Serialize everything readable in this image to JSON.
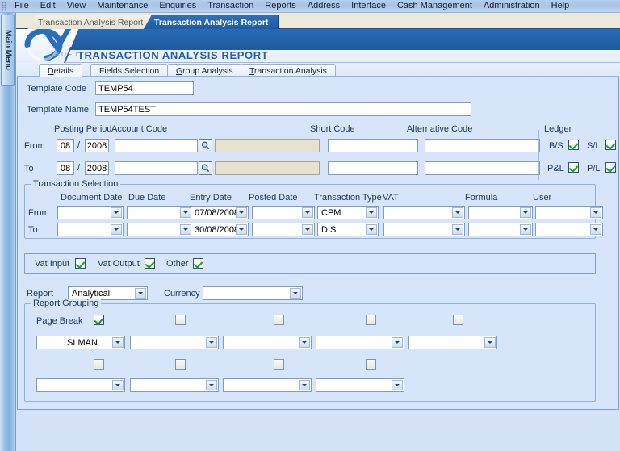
{
  "menubar": {
    "items": [
      "File",
      "Edit",
      "View",
      "Maintenance",
      "Enquiries",
      "Transaction",
      "Reports",
      "Address",
      "Interface",
      "Cash Management",
      "Administration",
      "Help"
    ]
  },
  "sidebar": {
    "label": "Main Menu"
  },
  "window_tabs": [
    {
      "label": "Transaction Analysis Report",
      "active": false
    },
    {
      "label": "Transaction Analysis Report",
      "active": true
    }
  ],
  "banner": {
    "title": "TRANSACTION ANALYSIS REPORT",
    "logo_text": "SOFT"
  },
  "inner_tabs": [
    {
      "label": "Details",
      "accel": "D",
      "selected": true
    },
    {
      "label": "Fields Selection",
      "accel": "",
      "selected": false
    },
    {
      "label": "Group Analysis",
      "accel": "G",
      "selected": false
    },
    {
      "label": "Transaction Analysis",
      "accel": "T",
      "selected": false
    }
  ],
  "form": {
    "template_code_label": "Template Code",
    "template_code_value": "TEMP54",
    "template_name_label": "Template Name",
    "template_name_value": "TEMP54TEST",
    "col_headers": {
      "posting_period": "Posting Period",
      "account_code": "Account Code",
      "short_code": "Short Code",
      "alternative_code": "Alternative Code",
      "ledger": "Ledger"
    },
    "row_from_label": "From",
    "row_to_label": "To",
    "from": {
      "period_month": "08",
      "period_sep": "/",
      "period_year": "2008",
      "account_code": "",
      "account_desc": "",
      "short_code": "",
      "alternative_code": ""
    },
    "to": {
      "period_month": "08",
      "period_sep": "/",
      "period_year": "2008",
      "account_code": "",
      "account_desc": "",
      "short_code": "",
      "alternative_code": ""
    },
    "ledger": {
      "bs_label": "B/S",
      "bs_checked": true,
      "sl_label": "S/L",
      "sl_checked": true,
      "pl_label": "P&L",
      "pl_checked": true,
      "pl2_label": "P/L",
      "pl2_checked": true
    }
  },
  "transaction_selection": {
    "title": "Transaction Selection",
    "row_from_label": "From",
    "row_to_label": "To",
    "headers": {
      "document_date": "Document Date",
      "due_date": "Due Date",
      "entry_date": "Entry Date",
      "posted_date": "Posted Date",
      "transaction_type": "Transaction Type",
      "vat": "VAT",
      "formula": "Formula",
      "user": "User"
    },
    "from": {
      "document_date": "",
      "due_date": "",
      "entry_date": "07/08/2008",
      "posted_date": "",
      "transaction_type": "CPM",
      "vat": "",
      "formula": "",
      "user": ""
    },
    "to": {
      "document_date": "",
      "due_date": "",
      "entry_date": "30/08/2008",
      "posted_date": "",
      "transaction_type": "DIS",
      "vat": "",
      "formula": "",
      "user": ""
    }
  },
  "vat_bar": {
    "vat_input_label": "Vat Input",
    "vat_input_checked": true,
    "vat_output_label": "Vat Output",
    "vat_output_checked": true,
    "other_label": "Other",
    "other_checked": true
  },
  "report_row": {
    "report_label": "Report",
    "report_value": "Analytical",
    "currency_label": "Currency",
    "currency_value": ""
  },
  "report_grouping": {
    "title": "Report Grouping",
    "page_break_label": "Page Break",
    "row1": {
      "checks": [
        true,
        false,
        false,
        false,
        false
      ],
      "values": [
        "SLMAN",
        "",
        "",
        "",
        ""
      ]
    },
    "row2": {
      "checks": [
        false,
        false,
        false,
        false
      ],
      "values": [
        "",
        "",
        "",
        ""
      ]
    }
  },
  "colors": {
    "panel_bg": "#d6e5f9",
    "accent_blue": "#1d5aa4",
    "title_blue": "#2460a8",
    "check_green": "#1e9e20",
    "readonly_beige": "#e6e1d0"
  }
}
